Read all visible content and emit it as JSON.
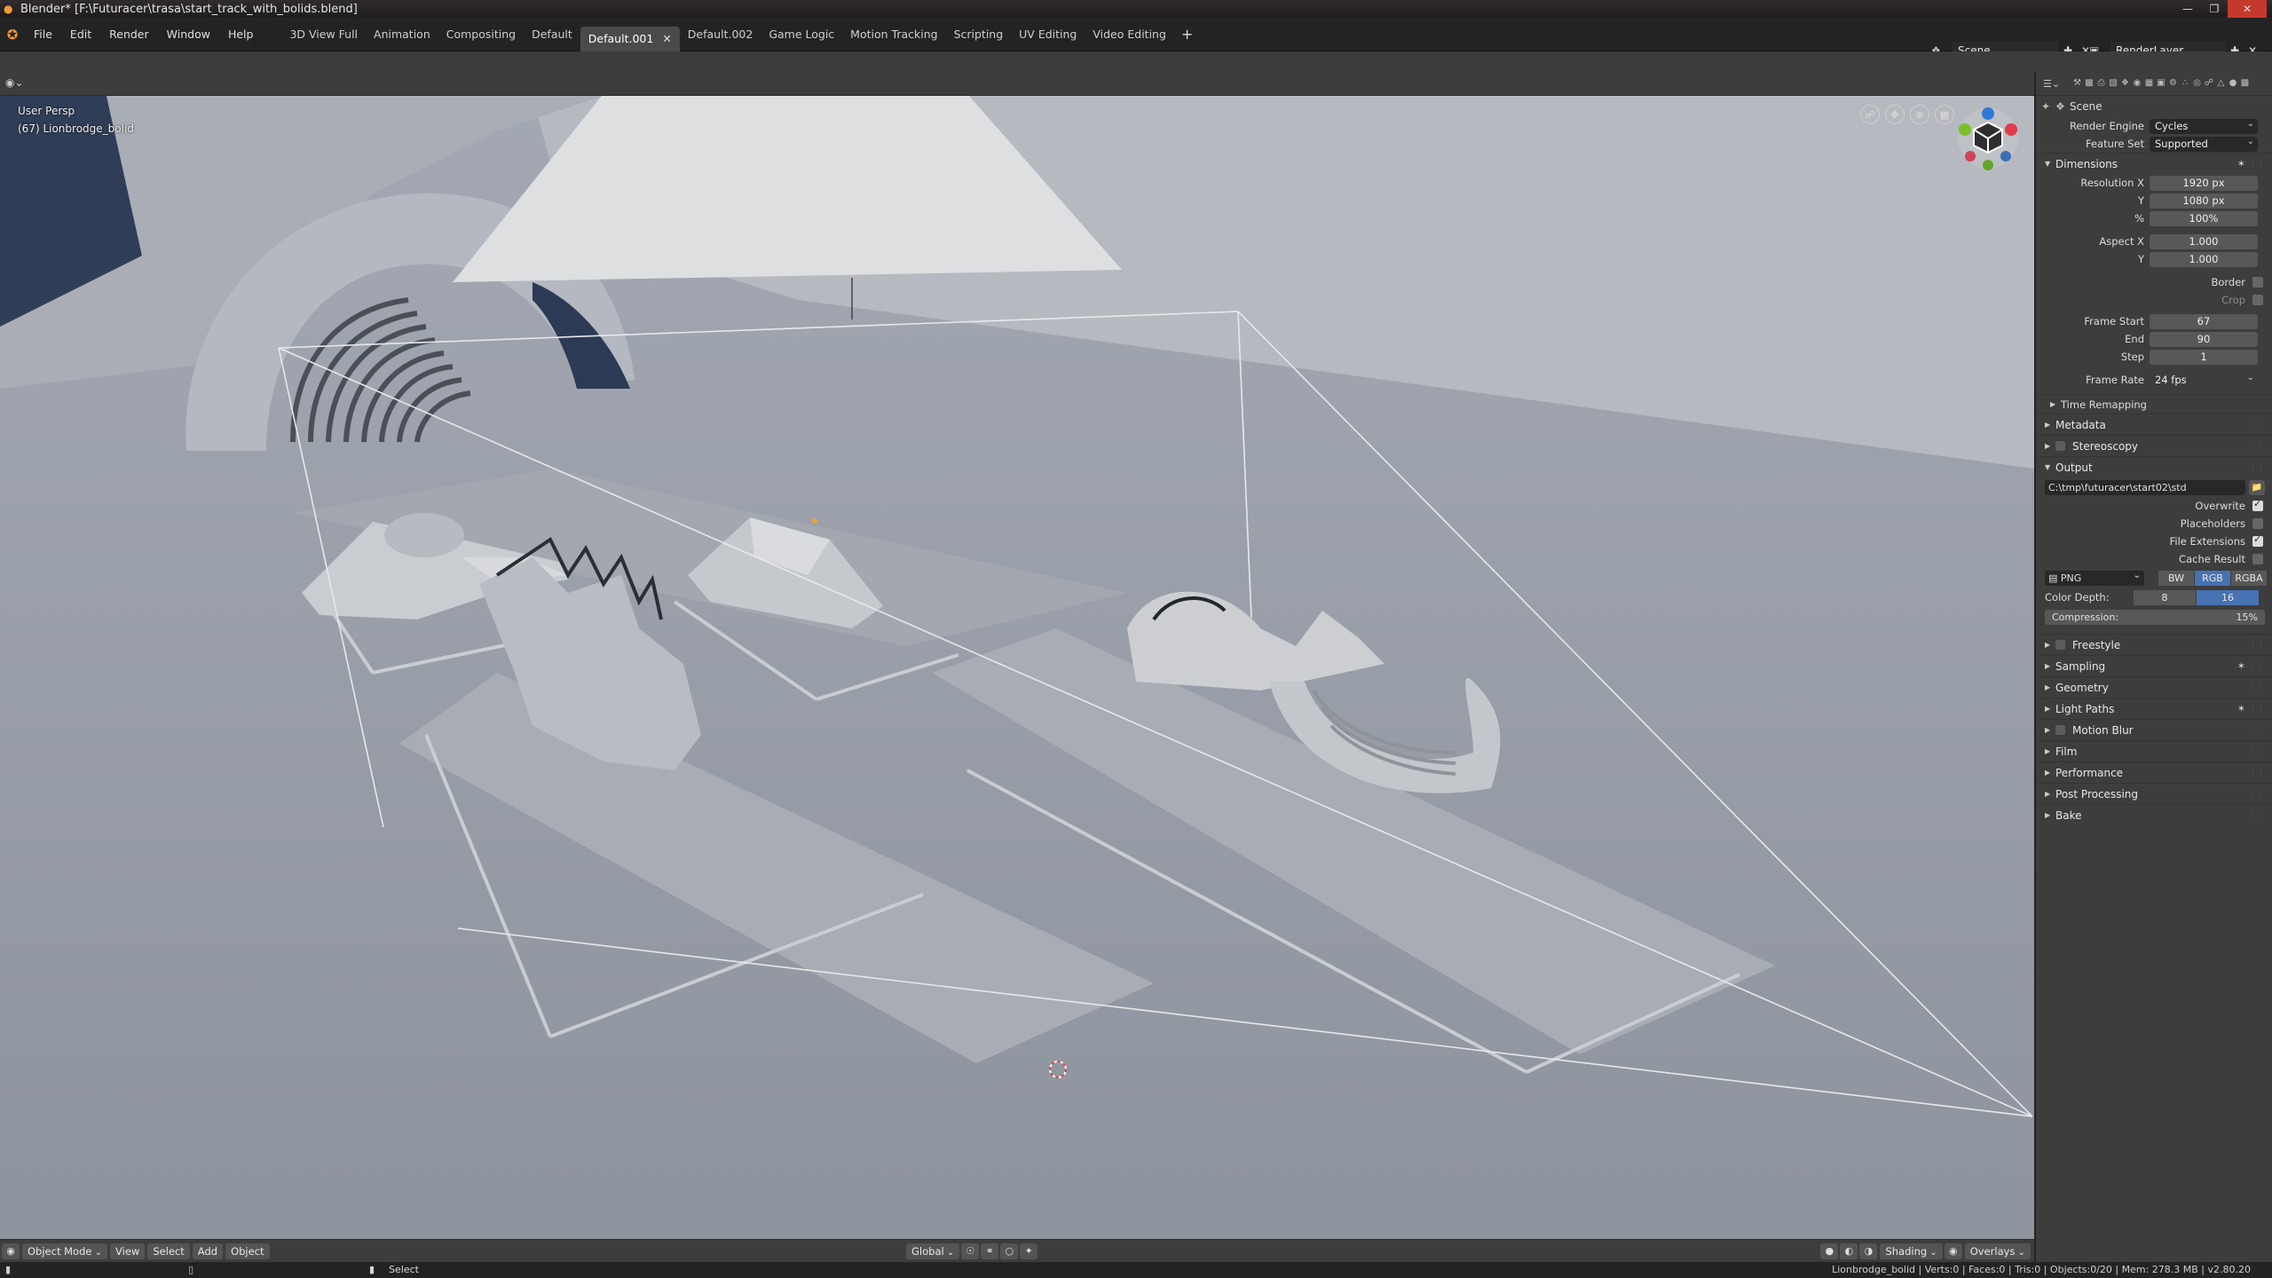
{
  "titlebar": {
    "text": "Blender* [F:\\Futuracer\\trasa\\start_track_with_bolids.blend]",
    "window_controls": [
      "—",
      "❐",
      "✕"
    ]
  },
  "menu": [
    "File",
    "Edit",
    "Render",
    "Window",
    "Help"
  ],
  "workspaces": [
    {
      "label": "3D View Full",
      "active": false
    },
    {
      "label": "Animation",
      "active": false
    },
    {
      "label": "Compositing",
      "active": false
    },
    {
      "label": "Default",
      "active": false
    },
    {
      "label": "Default.001",
      "active": true
    },
    {
      "label": "Default.002",
      "active": false
    },
    {
      "label": "Game Logic",
      "active": false
    },
    {
      "label": "Motion Tracking",
      "active": false
    },
    {
      "label": "Scripting",
      "active": false
    },
    {
      "label": "UV Editing",
      "active": false
    },
    {
      "label": "Video Editing",
      "active": false
    }
  ],
  "scene_selector": {
    "name": "Scene"
  },
  "layer_selector": {
    "name": "RenderLayer"
  },
  "viewport": {
    "perspective": "User Persp",
    "object": "(67) Lionbrodge_bolid"
  },
  "footer": {
    "mode": "Object Mode",
    "menus": [
      "View",
      "Select",
      "Add",
      "Object"
    ],
    "transform": "Global",
    "shading": "Shading",
    "overlays": "Overlays"
  },
  "statusbar": {
    "select": "Select",
    "stats": "Lionbrodge_bolid | Verts:0 | Faces:0 | Tris:0 | Objects:0/20 | Mem: 278.3 MB | v2.80.20"
  },
  "properties": {
    "context": "Scene",
    "render_engine": {
      "label": "Render Engine",
      "value": "Cycles"
    },
    "feature_set": {
      "label": "Feature Set",
      "value": "Supported"
    },
    "dimensions": {
      "title": "Dimensions",
      "resolution_x": {
        "label": "Resolution X",
        "value": "1920 px"
      },
      "resolution_y": {
        "label": "Y",
        "value": "1080 px"
      },
      "percent": {
        "label": "%",
        "value": "100%"
      },
      "aspect_x": {
        "label": "Aspect X",
        "value": "1.000"
      },
      "aspect_y": {
        "label": "Y",
        "value": "1.000"
      },
      "border": {
        "label": "Border",
        "checked": false
      },
      "crop": {
        "label": "Crop",
        "checked": false
      },
      "frame_start": {
        "label": "Frame Start",
        "value": "67"
      },
      "frame_end": {
        "label": "End",
        "value": "90"
      },
      "frame_step": {
        "label": "Step",
        "value": "1"
      },
      "frame_rate": {
        "label": "Frame Rate",
        "value": "24 fps"
      },
      "time_remapping": "Time Remapping"
    },
    "metadata": "Metadata",
    "stereoscopy": "Stereoscopy",
    "output": {
      "title": "Output",
      "path": "C:\\tmp\\futuracer\\start02\\std",
      "overwrite": {
        "label": "Overwrite",
        "checked": true
      },
      "placeholders": {
        "label": "Placeholders",
        "checked": false
      },
      "file_extensions": {
        "label": "File Extensions",
        "checked": true
      },
      "cache_result": {
        "label": "Cache Result",
        "checked": false
      },
      "format": "PNG",
      "color_modes": [
        {
          "label": "BW",
          "active": false
        },
        {
          "label": "RGB",
          "active": true
        },
        {
          "label": "RGBA",
          "active": false
        }
      ],
      "color_depth": {
        "label": "Color Depth:",
        "options": [
          {
            "label": "8",
            "active": false
          },
          {
            "label": "16",
            "active": true
          }
        ]
      },
      "compression": {
        "label": "Compression:",
        "value": "15%"
      }
    },
    "sections": [
      {
        "label": "Freestyle",
        "checkbox": true,
        "preset": false
      },
      {
        "label": "Sampling",
        "checkbox": false,
        "preset": true
      },
      {
        "label": "Geometry",
        "checkbox": false,
        "preset": false
      },
      {
        "label": "Light Paths",
        "checkbox": false,
        "preset": true
      },
      {
        "label": "Motion Blur",
        "checkbox": true,
        "preset": false
      },
      {
        "label": "Film",
        "checkbox": false,
        "preset": false
      },
      {
        "label": "Performance",
        "checkbox": false,
        "preset": false
      },
      {
        "label": "Post Processing",
        "checkbox": false,
        "preset": false
      },
      {
        "label": "Bake",
        "checkbox": false,
        "preset": false
      }
    ]
  },
  "colors": {
    "accent": "#4772b3",
    "viewport_bg": "#979da8",
    "blender_orange": "#f59a38"
  }
}
